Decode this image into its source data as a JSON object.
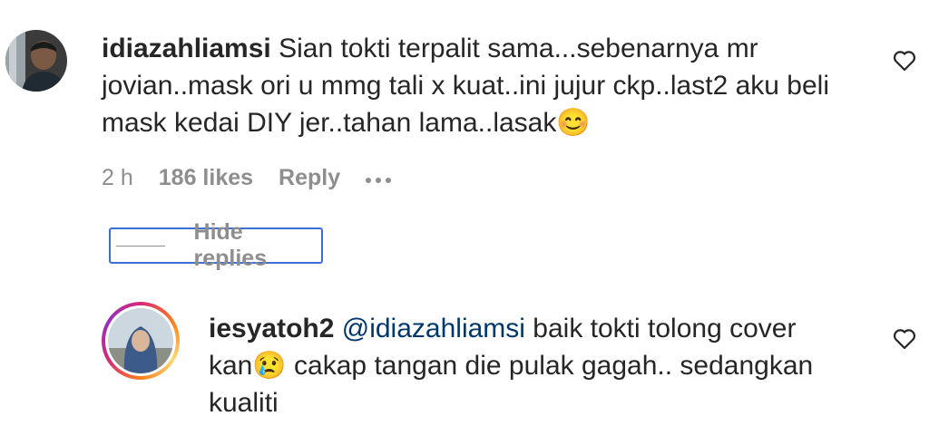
{
  "comment": {
    "username": "idiazahliamsi",
    "text_line1": "Sian tokti terpalit sama...sebenarnya mr",
    "text_line2": "jovian..mask ori u mmg tali x kuat..ini jujur ckp..last2 aku beli",
    "text_line3": "mask kedai DIY jer..tahan lama..lasak😊",
    "time": "2 h",
    "likes": "186 likes",
    "reply_label": "Reply",
    "hide_replies_label": "Hide replies"
  },
  "reply": {
    "username": "iesyatoh2",
    "mention": "@idiazahliamsi",
    "text_line1_rest": "baik tokti tolong cover",
    "text_line2": "kan😢 cakap tangan die pulak gagah.. sedangkan",
    "text_line3": "kualiti"
  },
  "icons": {
    "like": "heart-icon",
    "more": "more-options-icon"
  },
  "colors": {
    "text": "#262626",
    "secondary": "#8e8e8e",
    "mention": "#00376b",
    "focus_outline": "#3d6fd6"
  }
}
